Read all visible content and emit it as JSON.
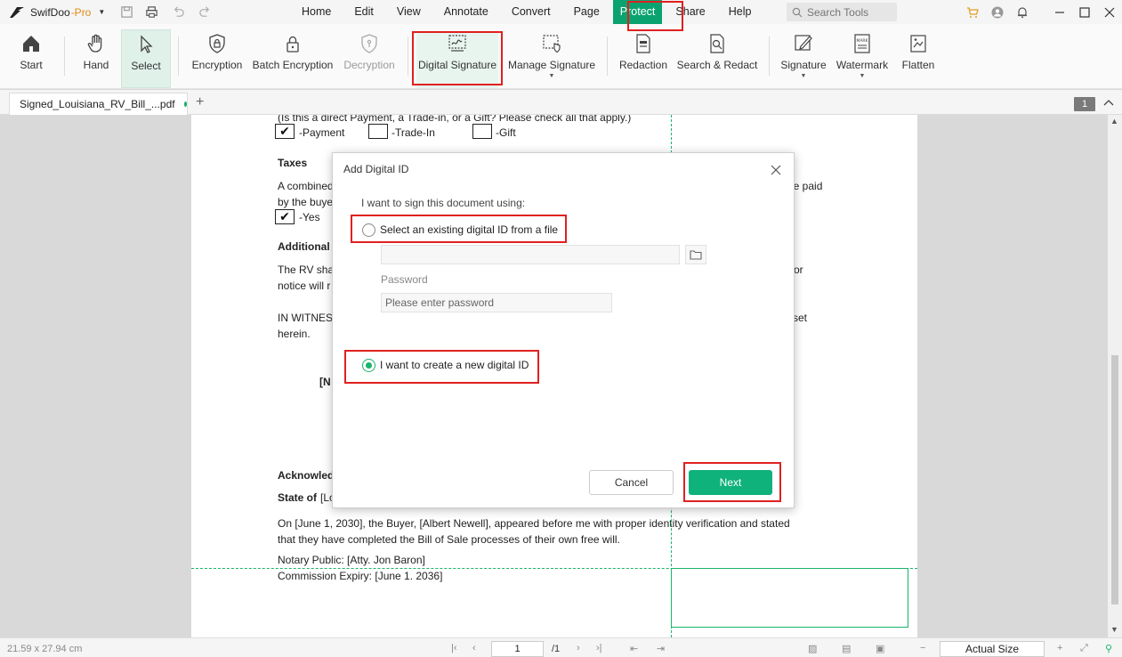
{
  "app": {
    "name": "SwifDoo",
    "edition": "-Pro"
  },
  "menu": [
    "Home",
    "Edit",
    "View",
    "Annotate",
    "Convert",
    "Page",
    "Protect",
    "Share",
    "Help"
  ],
  "active_menu": "Protect",
  "search": {
    "placeholder": "Search Tools"
  },
  "ribbon": {
    "start": "Start",
    "hand": "Hand",
    "select": "Select",
    "encryption": "Encryption",
    "batch_encryption": "Batch Encryption",
    "decryption": "Decryption",
    "digital_signature": "Digital Signature",
    "manage_signature": "Manage Signature",
    "redaction": "Redaction",
    "search_redact": "Search & Redact",
    "signature": "Signature",
    "watermark": "Watermark",
    "flatten": "Flatten"
  },
  "tab": {
    "filename": "Signed_Louisiana_RV_Bill_...pdf",
    "page_count_badge": "1"
  },
  "document": {
    "line1": "(Is this a direct Payment, a Trade-in, or a Gift? Please check all that apply.)",
    "check_mark": "✔",
    "payment": "-Payment",
    "trade_in": "-Trade-In",
    "gift": "-Gift",
    "taxes_heading": "Taxes",
    "taxes_line1_start": "A combined",
    "taxes_line1_end": "be paid",
    "taxes_line2_start": "by the buye",
    "yes": "-Yes",
    "additional_heading": "Additional",
    "rv_line1_start": "The RV shal",
    "rv_line1_end": "or",
    "rv_line2_start": "notice will r",
    "witness_start": "IN WITNESS",
    "witness_end": "set",
    "herein": "herein.",
    "bracket_n": "[N",
    "acknowledged": "Acknowled",
    "state_of_label": "State of",
    "state_of_value": "[Lo",
    "notary_line1": "On [June 1, 2030], the Buyer, [Albert Newell], appeared before me with proper identity verification and stated",
    "notary_line2": "that they have completed the Bill of Sale processes of their own free will.",
    "notary_public": "Notary Public: [Atty. Jon Baron]",
    "commission": "Commission Expiry: [June 1. 2036]"
  },
  "dialog": {
    "title": "Add Digital ID",
    "prompt": "I want to sign this document using:",
    "option_existing": "Select an existing digital ID from a file",
    "password_label": "Password",
    "password_placeholder": "Please enter password",
    "option_create": "I want to create a new digital ID",
    "selected_option": "create",
    "cancel": "Cancel",
    "next": "Next"
  },
  "status": {
    "page_size": "21.59 x 27.94 cm",
    "current_page": "1",
    "total_pages": "/1",
    "zoom": "Actual Size"
  },
  "colors": {
    "accent": "#0aa36f",
    "highlight": "#e02020",
    "next_button": "#0fb27a"
  }
}
